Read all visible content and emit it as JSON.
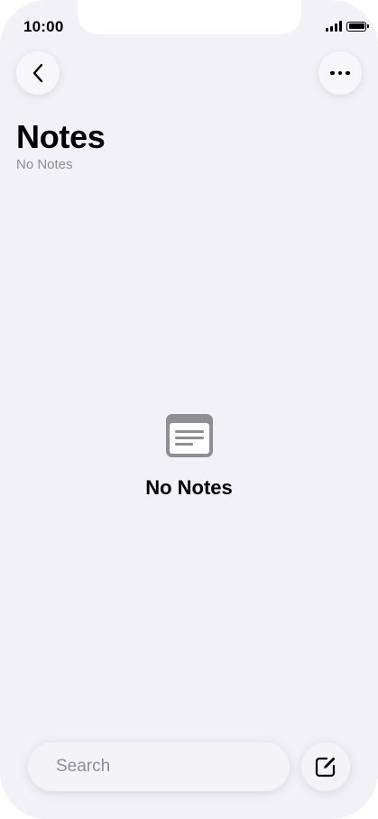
{
  "status_bar": {
    "time": "10:00",
    "signal_icon": "cellular-signal-icon",
    "battery_icon": "battery-icon"
  },
  "nav": {
    "back_icon": "chevron-left-icon",
    "more_icon": "ellipsis-icon"
  },
  "header": {
    "title": "Notes",
    "subtitle": "No Notes"
  },
  "empty_state": {
    "icon": "notes-list-icon",
    "label": "No Notes"
  },
  "bottom_bar": {
    "search_placeholder": "Search",
    "search_value": "",
    "search_icon": "magnifier-icon",
    "mic_icon": "microphone-icon",
    "compose_icon": "compose-icon"
  },
  "colors": {
    "background": "#f2f1f6",
    "secondary_text": "#8e8e93",
    "icon_gray": "#8e8e93"
  }
}
